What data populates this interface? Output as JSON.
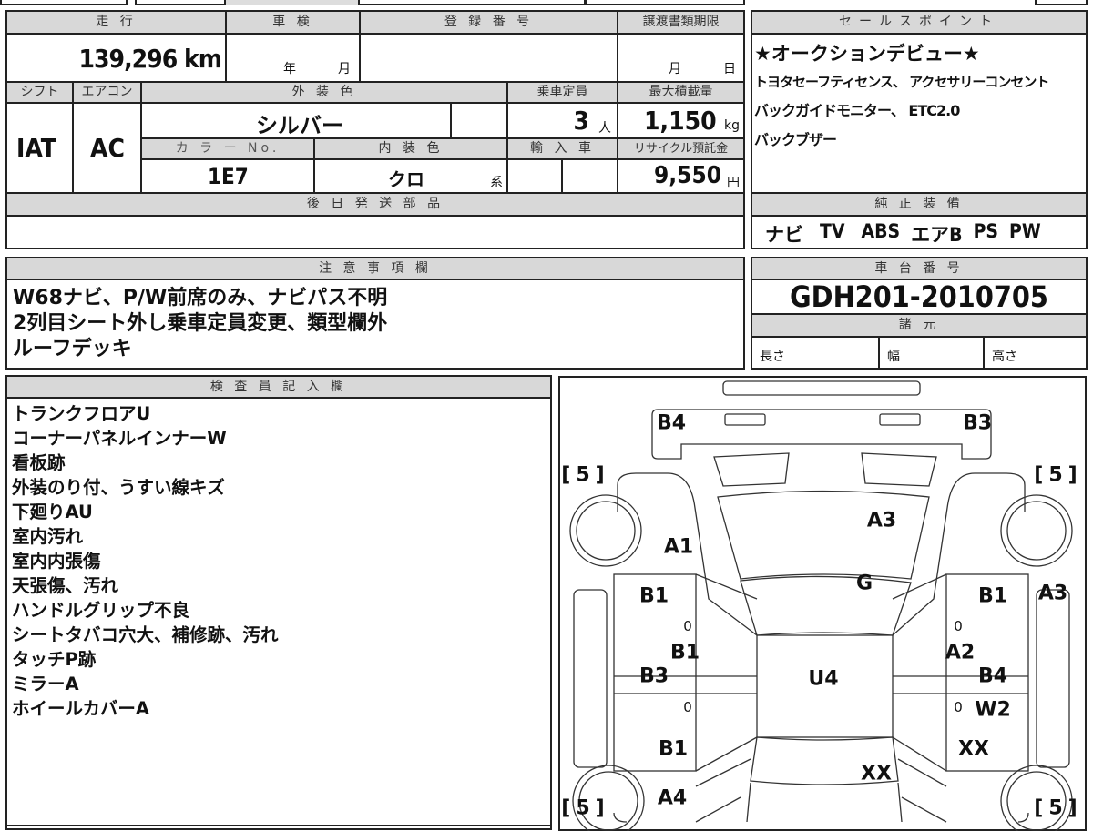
{
  "vehicle_table": {
    "mileage_label": "走 行",
    "mileage_value": "139,296 km",
    "shaken_label": "車 検",
    "shaken_year": "年",
    "shaken_month": "月",
    "registration_label": "登 録 番 号",
    "transfer_deadline_label": "譲渡書類期限",
    "transfer_month": "月",
    "transfer_day": "日",
    "shift_label": "シフト",
    "shift_value": "IAT",
    "aircon_label": "エアコン",
    "aircon_value": "AC",
    "exterior_color_label": "外 装 色",
    "exterior_color_value": "シルバー",
    "capacity_label": "乗車定員",
    "capacity_value": "3",
    "capacity_unit": "人",
    "max_load_label": "最大積載量",
    "max_load_value": "1,150",
    "max_load_unit": "kg",
    "color_no_label": "カ ラ ー No.",
    "color_no_value": "1E7",
    "interior_color_label": "内 装 色",
    "interior_color_value": "クロ",
    "interior_color_suffix": "系",
    "import_label": "輸 入 車",
    "recycle_label": "リサイクル預託金",
    "recycle_value": "9,550",
    "recycle_unit": "円",
    "later_parts_label": "後 日 発 送 部 品"
  },
  "sales_point": {
    "label": "セールスポイント",
    "lines": [
      "★オークションデビュー★",
      "トヨタセーフティセンス、 アクセサリーコンセント",
      "バックガイドモニター、 ETC2.0",
      "バックブザー"
    ]
  },
  "genuine_equipment": {
    "label": "純 正 装 備",
    "items": [
      "ナビ",
      "TV",
      "ABS",
      "エアB",
      "PS",
      "PW"
    ]
  },
  "notes": {
    "label": "注 意 事 項 欄",
    "lines": [
      "W68ナビ、P/W前席のみ、ナビパス不明",
      "2列目シート外し乗車定員変更、類型欄外",
      "ルーフデッキ"
    ]
  },
  "chassis": {
    "label": "車 台 番 号",
    "value": "GDH201-2010705",
    "specs_label": "諸 元",
    "length_label": "長さ",
    "width_label": "幅",
    "height_label": "高さ"
  },
  "inspector": {
    "label": "検 査 員 記 入 欄",
    "lines": [
      "トランクフロアU",
      "コーナーパネルインナーW",
      "看板跡",
      "外装のり付、うすい線キズ",
      "下廻りAU",
      "室内汚れ",
      "室内内張傷",
      "天張傷、汚れ",
      "ハンドルグリップ不良",
      "シートタバコ穴大、補修跡、汚れ",
      "タッチP跡",
      "ミラーA",
      "ホイールカバーA"
    ]
  },
  "diagram": {
    "tire_tread": [
      "[5]",
      "[5]",
      "[5]",
      "[5]"
    ],
    "marks": [
      "B4",
      "B3",
      "A3",
      "A1",
      "G",
      "B1",
      "B1",
      "A3",
      "B1",
      "A2",
      "B3",
      "U4",
      "B4",
      "W2",
      "B1",
      "XX",
      "XX",
      "A4"
    ],
    "zeros": [
      "0",
      "0",
      "0",
      "0"
    ]
  }
}
